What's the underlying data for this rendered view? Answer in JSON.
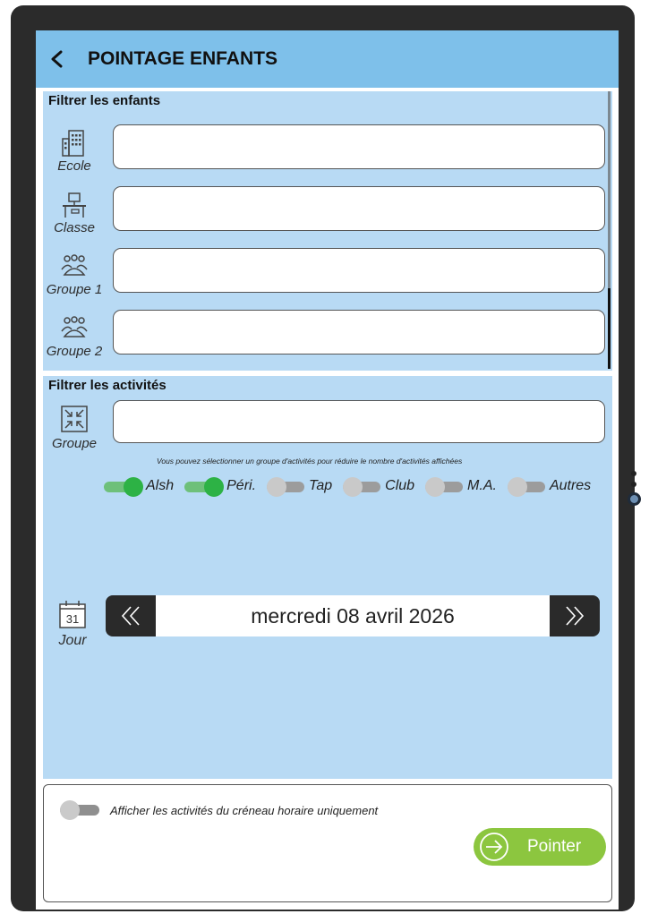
{
  "header": {
    "title": "POINTAGE ENFANTS"
  },
  "filtres_enfants": {
    "title": "Filtrer les enfants",
    "fields": [
      {
        "label": "Ecole",
        "icon": "school-building-icon",
        "value": ""
      },
      {
        "label": "Classe",
        "icon": "desk-classroom-icon",
        "value": ""
      },
      {
        "label": "Groupe 1",
        "icon": "group-people-icon",
        "value": ""
      },
      {
        "label": "Groupe 2",
        "icon": "group-people-icon",
        "value": ""
      }
    ]
  },
  "filtres_activites": {
    "title": "Filtrer les activités",
    "groupe": {
      "label": "Groupe",
      "icon": "compress-arrows-icon",
      "value": ""
    },
    "hint": "Vous pouvez sélectionner un groupe d'activités pour réduire le nombre d'activités affichées",
    "toggles": [
      {
        "label": "Alsh",
        "on": true
      },
      {
        "label": "Péri.",
        "on": true
      },
      {
        "label": "Tap",
        "on": false
      },
      {
        "label": "Club",
        "on": false
      },
      {
        "label": "M.A.",
        "on": false
      },
      {
        "label": "Autres",
        "on": false
      }
    ]
  },
  "date": {
    "label": "Jour",
    "calendar_day": "31",
    "value": "mercredi 08 avril 2026",
    "prev_icon": "double-chevron-left-icon",
    "next_icon": "double-chevron-right-icon"
  },
  "bottom": {
    "creneau_label": "Afficher les activités du créneau horaire uniquement",
    "creneau_on": false,
    "pointer_label": "Pointer"
  },
  "colors": {
    "header": "#7ec0ea",
    "panel": "#b8daf4",
    "toggle_on": "#2db245",
    "pointer_button": "#8cc63f",
    "date_bar": "#2a2a2a"
  }
}
